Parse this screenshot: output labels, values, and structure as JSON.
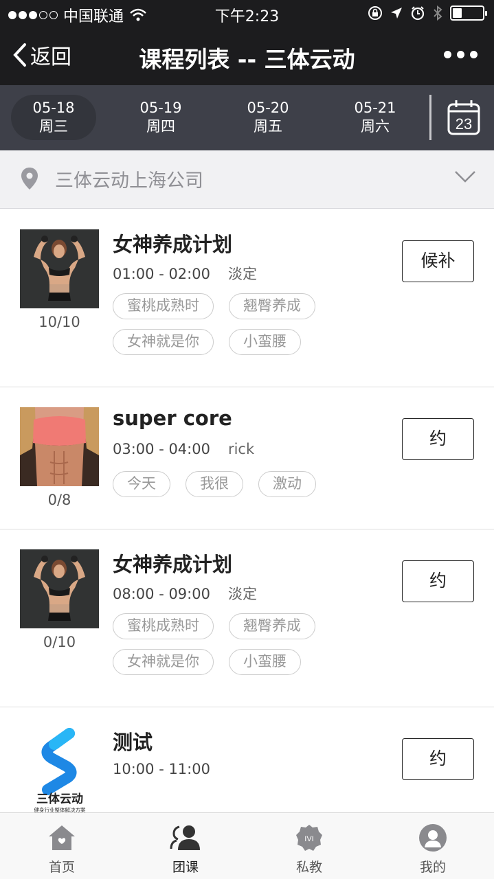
{
  "status": {
    "carrier": "中国联通",
    "time": "下午2:23",
    "signal_on": 3,
    "signal_total": 5,
    "battery_level": 0.3
  },
  "nav": {
    "back_label": "返回",
    "title": "课程列表 -- 三体云动"
  },
  "dates": [
    {
      "date": "05-18",
      "weekday": "周三",
      "active": true
    },
    {
      "date": "05-19",
      "weekday": "周四",
      "active": false
    },
    {
      "date": "05-20",
      "weekday": "周五",
      "active": false
    },
    {
      "date": "05-21",
      "weekday": "周六",
      "active": false
    }
  ],
  "calendar": {
    "day": "23"
  },
  "location": {
    "name": "三体云动上海公司"
  },
  "courses": [
    {
      "name": "女神养成计划",
      "time": "01:00 - 02:00",
      "coach": "淡定",
      "count": "10/10",
      "tags": [
        "蜜桃成熟时",
        "翘臀养成",
        "女神就是你",
        "小蛮腰"
      ],
      "action": "候补",
      "image": "fitness-woman-photo"
    },
    {
      "name": "super core",
      "time": "03:00 - 04:00",
      "coach": "rick",
      "count": "0/8",
      "tags": [
        "今天",
        "我很",
        "激动"
      ],
      "action": "约",
      "image": "fitness-abs-photo"
    },
    {
      "name": "女神养成计划",
      "time": "08:00 - 09:00",
      "coach": "淡定",
      "count": "0/10",
      "tags": [
        "蜜桃成熟时",
        "翘臀养成",
        "女神就是你",
        "小蛮腰"
      ],
      "action": "约",
      "image": "fitness-woman-photo"
    },
    {
      "name": "测试",
      "time": "10:00 - 11:00",
      "coach": "",
      "count": "",
      "tags": [],
      "action": "约",
      "image": "brand-logo",
      "logo_text": "三体云动",
      "logo_sub": "健身行业整体解决方案"
    }
  ],
  "tabs": [
    {
      "label": "首页",
      "icon": "home-icon"
    },
    {
      "label": "团课",
      "icon": "group-class-icon"
    },
    {
      "label": "私教",
      "icon": "personal-trainer-icon"
    },
    {
      "label": "我的",
      "icon": "profile-icon"
    }
  ],
  "colors": {
    "dark_bar": "#1c1c1e",
    "date_bar": "#3e4049",
    "logo_blue": "#1e88e5"
  }
}
